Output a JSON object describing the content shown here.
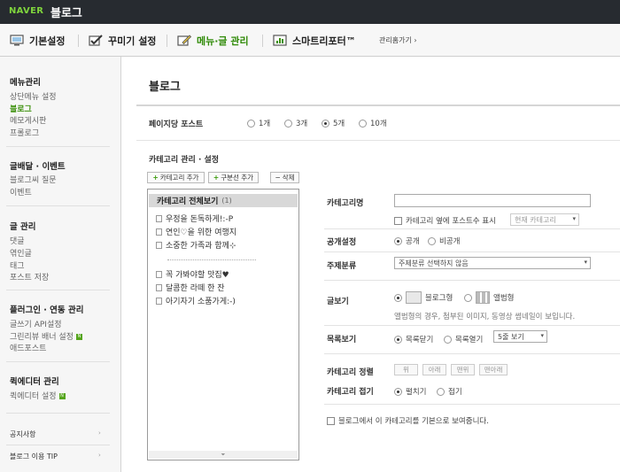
{
  "app": {
    "logo_naver": "NAVER",
    "logo_blog": "블로그"
  },
  "tabs": [
    {
      "label": "기본설정",
      "icon": "monitor-icon"
    },
    {
      "label": "꾸미기 설정",
      "icon": "checkmark-icon"
    },
    {
      "label": "메뉴·글 관리",
      "icon": "pencil-icon"
    },
    {
      "label": "스마트리포터™",
      "icon": "chart-icon"
    }
  ],
  "admin_link": "관리홈가기 ›",
  "sidebar": {
    "sections": [
      {
        "title": "메뉴관리",
        "items": [
          "상단메뉴 설정",
          "블로그",
          "메모게시판",
          "프롤로그"
        ]
      },
      {
        "title": "글배달 · 이벤트",
        "items": [
          "블로그씨 질문",
          "이벤트"
        ]
      },
      {
        "title": "글 관리",
        "items": [
          "댓글",
          "엮인글",
          "태그",
          "포스트 저장"
        ]
      },
      {
        "title": "플러그인 · 연동 관리",
        "items": [
          "글쓰기 API설정",
          "그린리뷰 배너 설정",
          "애드포스트"
        ]
      },
      {
        "title": "퀵에디터 관리",
        "items": [
          "퀵에디터 설정"
        ]
      }
    ],
    "new_badge": "N",
    "footer": [
      "공지사항",
      "블로그 이용 TIP"
    ]
  },
  "main": {
    "title": "블로그",
    "posts_per_page": {
      "label": "페이지당 포스트",
      "options": [
        "1개",
        "3개",
        "5개",
        "10개"
      ],
      "selected": "5개"
    },
    "category": {
      "section_title": "카테고리 관리 · 설정",
      "add_category": "카테고리 추가",
      "add_divider": "구분선 추가",
      "delete": "삭제",
      "all_label": "카테고리 전체보기",
      "all_count": "(1)",
      "items_top": [
        "우정을 돈독하게!:-P",
        "연인♡을 위한 여행지",
        "소중한 가족과 함께⊹"
      ],
      "items_bottom": [
        "꼭 가봐야할 맛집♥",
        "달콤한 라떼 한 잔",
        "아기자기 소품가게:-)"
      ],
      "scroll_glyph": "⏷"
    },
    "form": {
      "name_label": "카테고리명",
      "name_value": "",
      "show_count_label": "카테고리 옆에 포스트수 표시",
      "show_count_select": "현재 카테고리",
      "public_label": "공개설정",
      "public_options": [
        "공개",
        "비공개"
      ],
      "public_selected": "공개",
      "topic_label": "주제분류",
      "topic_select": "주제분류 선택하지 않음",
      "view_label": "글보기",
      "view_options": [
        "블로그형",
        "앨범형"
      ],
      "view_selected": "블로그형",
      "view_note": "앨범형의 경우, 첨부된 이미지, 동영상 썸네일이 보입니다.",
      "list_label": "목록보기",
      "list_options": [
        "목록닫기",
        "목록열기"
      ],
      "list_selected": "목록닫기",
      "list_select": "5줄 보기",
      "order_label": "카테고리 정렬",
      "order_buttons": [
        "위",
        "아래",
        "맨위",
        "맨아래"
      ],
      "fold_label": "카테고리 접기",
      "fold_options": [
        "펼치기",
        "접기"
      ],
      "fold_selected": "펼치기",
      "default_label": "블로그에서 이 카테고리를 기본으로 보여줍니다."
    }
  },
  "colors": {
    "topbar": "#272b30",
    "accent": "#3a8f0a",
    "naver_green": "#7fd43d"
  }
}
